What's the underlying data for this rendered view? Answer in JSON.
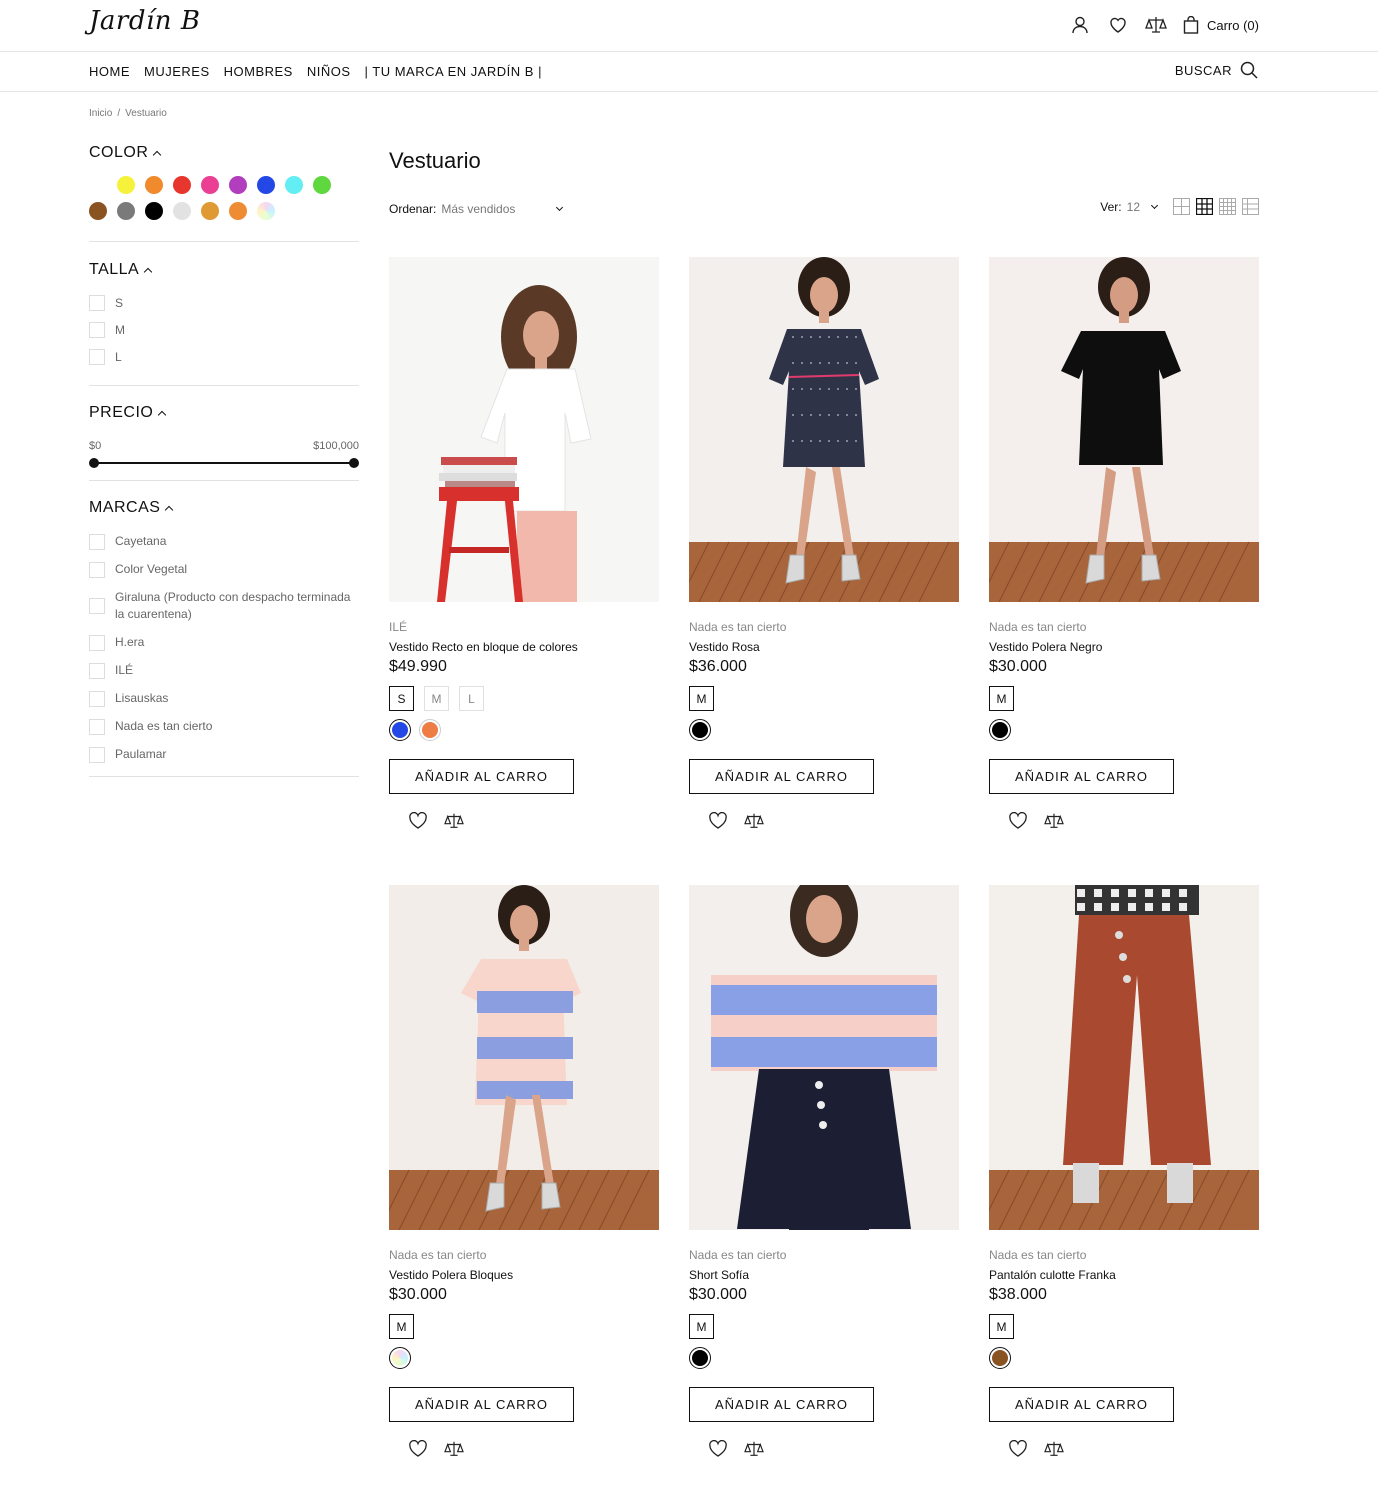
{
  "header": {
    "logo": "Jardín B",
    "cart_label": "Carro (0)"
  },
  "nav": {
    "links": [
      "HOME",
      "MUJERES",
      "HOMBRES",
      "NIÑOS",
      "| TU MARCA EN JARDÍN B |"
    ],
    "search_label": "BUSCAR"
  },
  "breadcrumb": {
    "home": "Inicio",
    "sep": "/",
    "current": "Vestuario"
  },
  "filters": {
    "color": {
      "title": "COLOR",
      "swatches": [
        "#ffffff",
        "#f6f23b",
        "#f08a2c",
        "#e7362d",
        "#ea3f93",
        "#b13ebc",
        "#2348e6",
        "#62eef2",
        "#5fd83f",
        "#8a5422",
        "#7a7a7a",
        "#000000",
        "#e2e2e2",
        "#e09a33",
        "#ee8c34",
        "iridescent"
      ]
    },
    "talla": {
      "title": "TALLA",
      "options": [
        "S",
        "M",
        "L"
      ]
    },
    "precio": {
      "title": "PRECIO",
      "min_label": "$0",
      "max_label": "$100,000"
    },
    "marcas": {
      "title": "MARCAS",
      "options": [
        "Cayetana",
        "Color Vegetal",
        "Giraluna (Producto con despacho terminada la cuarentena)",
        "H.era",
        "ILÉ",
        "Lisauskas",
        "Nada es tan cierto",
        "Paulamar"
      ]
    }
  },
  "main": {
    "title": "Vestuario",
    "sort_label": "Ordenar:",
    "sort_value": "Más vendidos",
    "view_label": "Ver:",
    "view_value": "12"
  },
  "products": [
    {
      "brand": "ILÉ",
      "name": "Vestido Recto en bloque de colores",
      "price": "$49.990",
      "sizes": [
        "S",
        "M",
        "L"
      ],
      "selected_size": "S",
      "colors": [
        "#2348e6",
        "#ee7c45"
      ],
      "selected_color": 0,
      "button": "AÑADIR AL CARRO"
    },
    {
      "brand": "Nada es tan cierto",
      "name": "Vestido Rosa",
      "price": "$36.000",
      "sizes": [
        "M"
      ],
      "selected_size": "M",
      "colors": [
        "#000000"
      ],
      "selected_color": 0,
      "button": "AÑADIR AL CARRO"
    },
    {
      "brand": "Nada es tan cierto",
      "name": "Vestido Polera Negro",
      "price": "$30.000",
      "sizes": [
        "M"
      ],
      "selected_size": "M",
      "colors": [
        "#000000"
      ],
      "selected_color": 0,
      "button": "AÑADIR AL CARRO"
    },
    {
      "brand": "Nada es tan cierto",
      "name": "Vestido Polera Bloques",
      "price": "$30.000",
      "sizes": [
        "M"
      ],
      "selected_size": "M",
      "colors": [
        "iridescent"
      ],
      "selected_color": 0,
      "button": "AÑADIR AL CARRO"
    },
    {
      "brand": "Nada es tan cierto",
      "name": "Short Sofía",
      "price": "$30.000",
      "sizes": [
        "M"
      ],
      "selected_size": "M",
      "colors": [
        "#000000"
      ],
      "selected_color": 0,
      "button": "AÑADIR AL CARRO"
    },
    {
      "brand": "Nada es tan cierto",
      "name": "Pantalón culotte Franka",
      "price": "$38.000",
      "sizes": [
        "M"
      ],
      "selected_size": "M",
      "colors": [
        "#8a5422"
      ],
      "selected_color": 0,
      "button": "AÑADIR AL CARRO"
    }
  ]
}
